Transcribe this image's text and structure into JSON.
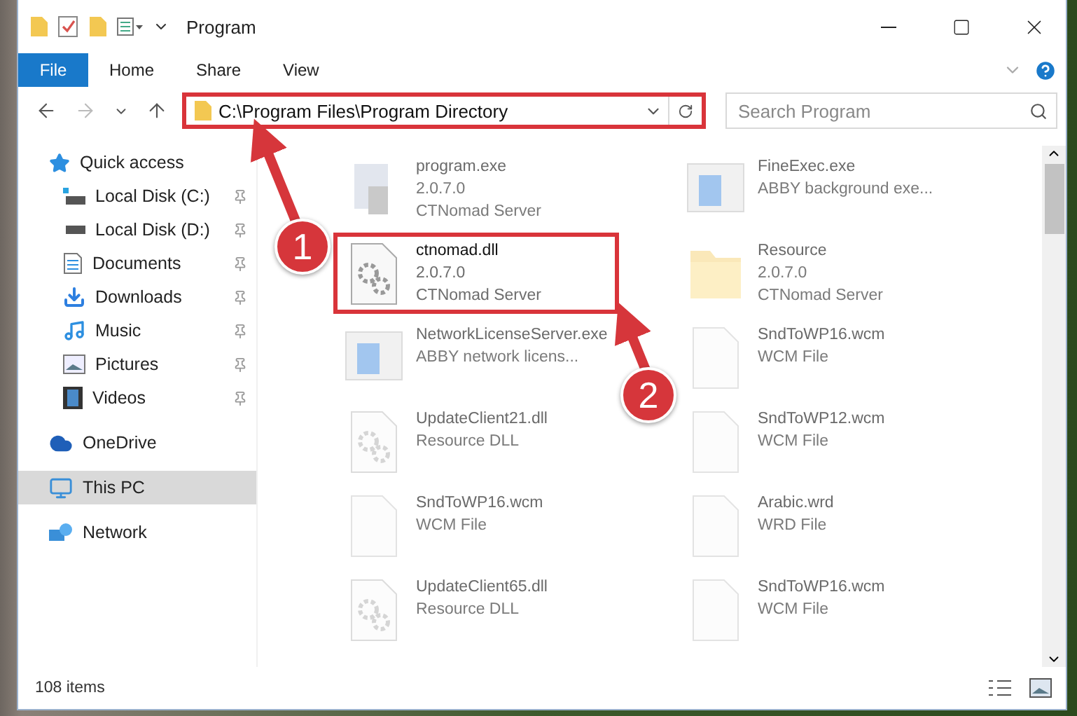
{
  "window": {
    "title": "Program"
  },
  "ribbon_tabs": [
    {
      "label": "File",
      "kind": "file",
      "selected": false
    },
    {
      "label": "Home",
      "kind": "tab",
      "selected": false
    },
    {
      "label": "Share",
      "kind": "tab",
      "selected": false
    },
    {
      "label": "View",
      "kind": "tab",
      "selected": false
    }
  ],
  "address_bar": {
    "value": "C:\\Program Files\\Program Directory",
    "highlighted": true
  },
  "search": {
    "placeholder": "Search Program"
  },
  "sidebar": {
    "items": [
      {
        "label": "Quick access",
        "selected": false,
        "children": [
          {
            "label": "Local Disk (C:)",
            "pinned": true
          },
          {
            "label": "Local Disk (D:)",
            "pinned": true
          },
          {
            "label": "Documents",
            "pinned": true
          },
          {
            "label": "Downloads",
            "pinned": true
          },
          {
            "label": "Music",
            "pinned": true
          },
          {
            "label": "Pictures",
            "pinned": true
          },
          {
            "label": "Videos",
            "pinned": true
          }
        ]
      },
      {
        "label": "OneDrive",
        "selected": false
      },
      {
        "label": "This PC",
        "selected": true
      },
      {
        "label": "Network",
        "selected": false
      }
    ]
  },
  "files": [
    {
      "name": "program.exe",
      "lines": [
        "2.0.7.0",
        "CTNomad Server"
      ],
      "faded": true,
      "highlighted": false
    },
    {
      "name": "FineExec.exe",
      "lines": [
        "ABBY background exe..."
      ],
      "faded": true,
      "highlighted": false
    },
    {
      "name": "ctnomad.dll",
      "lines": [
        "2.0.7.0",
        "CTNomad Server"
      ],
      "faded": false,
      "highlighted": true
    },
    {
      "name": "Resource",
      "lines": [
        "2.0.7.0",
        "CTNomad Server"
      ],
      "faded": true,
      "highlighted": false
    },
    {
      "name": "NetworkLicenseServer.exe",
      "lines": [
        "ABBY network licens..."
      ],
      "faded": true,
      "highlighted": false
    },
    {
      "name": "SndToWP16.wcm",
      "lines": [
        "WCM File"
      ],
      "faded": true,
      "highlighted": false
    },
    {
      "name": "UpdateClient21.dll",
      "lines": [
        "Resource DLL"
      ],
      "faded": true,
      "highlighted": false
    },
    {
      "name": "SndToWP12.wcm",
      "lines": [
        "WCM File"
      ],
      "faded": true,
      "highlighted": false
    },
    {
      "name": "SndToWP16.wcm",
      "lines": [
        "WCM File"
      ],
      "faded": true,
      "highlighted": false
    },
    {
      "name": "Arabic.wrd",
      "lines": [
        "WRD File"
      ],
      "faded": true,
      "highlighted": false
    },
    {
      "name": "UpdateClient65.dll",
      "lines": [
        "Resource DLL"
      ],
      "faded": true,
      "highlighted": false
    },
    {
      "name": "SndToWP16.wcm",
      "lines": [
        "WCM File"
      ],
      "faded": true,
      "highlighted": false
    }
  ],
  "status_bar": {
    "count": "108 items"
  },
  "annotations": [
    {
      "number": "1"
    },
    {
      "number": "2"
    }
  ]
}
